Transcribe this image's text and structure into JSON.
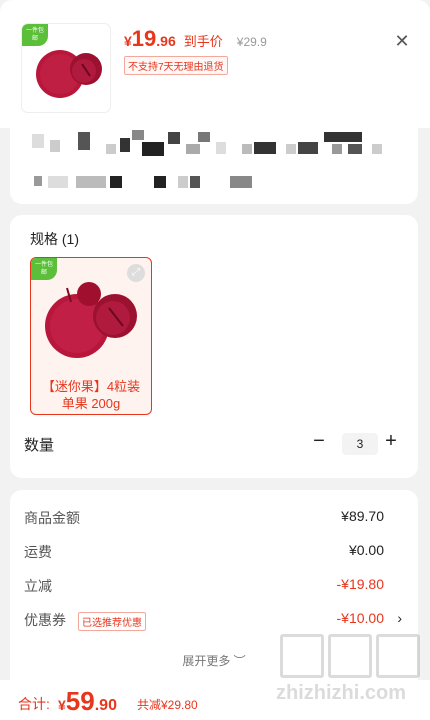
{
  "header": {
    "badge": "一件包邮",
    "price_yen": "¥",
    "price_int": "19",
    "price_dec": ".96",
    "price_tag": "到手价",
    "price_old": "¥29.9",
    "return_policy": "不支持7天无理由退货",
    "close_icon": "close-icon"
  },
  "spec": {
    "title": "规格 (1)",
    "item_badge": "一件包邮",
    "item_label": "【迷你果】4粒装 单果 200g",
    "zoom_icon": "expand-icon"
  },
  "quantity": {
    "label": "数量",
    "minus": "−",
    "value": "3",
    "plus": "+"
  },
  "summary": {
    "rows": [
      {
        "key": "商品金额",
        "value": "¥89.70"
      },
      {
        "key": "运费",
        "value": "¥0.00"
      },
      {
        "key": "立减",
        "value": "-¥19.80"
      },
      {
        "key": "优惠券",
        "value": "-¥10.00"
      }
    ],
    "coupon_badge": "已选推荐优惠",
    "coupon_chevron": "›",
    "more": "展开更多 ︶"
  },
  "footer": {
    "total_label": "合计:",
    "yen": "¥",
    "total_int": "59",
    "total_dec": ".90",
    "saved": "共减¥29.80"
  },
  "watermark": {
    "text": "zhizhizhi.com"
  },
  "colors": {
    "accent": "#e8361d",
    "badge_green": "#5cbf3a",
    "fruit": "#b8163a"
  }
}
